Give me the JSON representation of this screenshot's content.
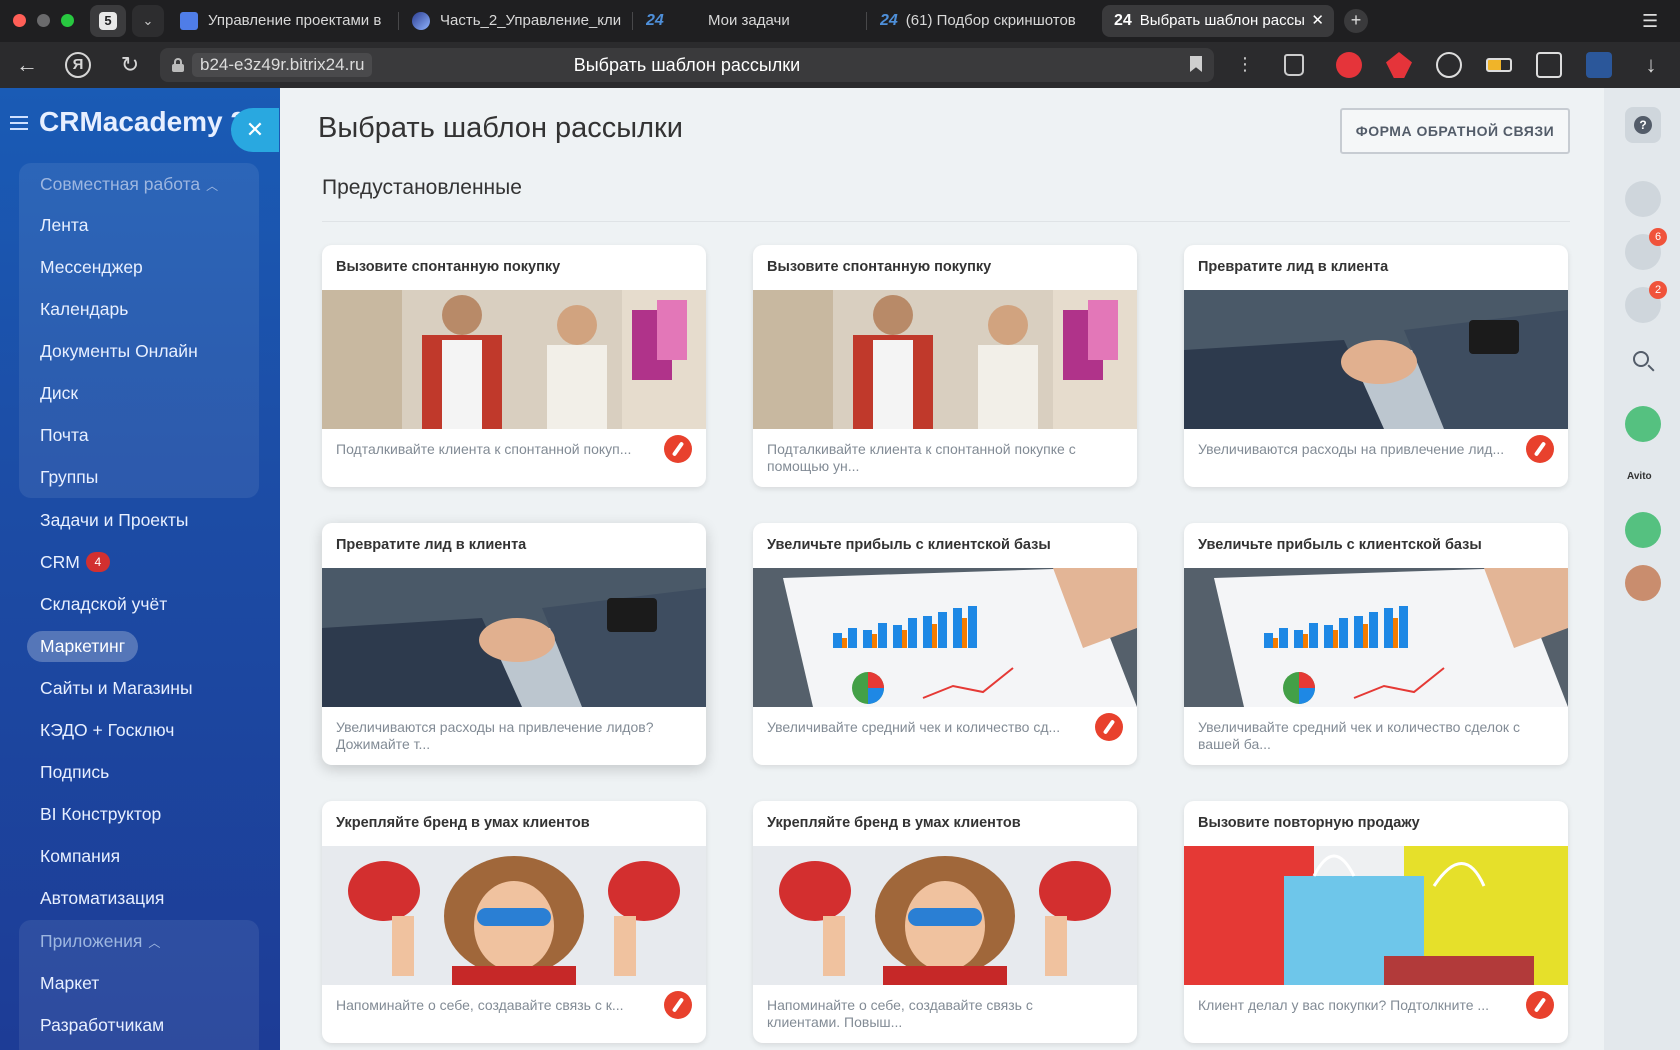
{
  "browser": {
    "tab_counter": "5",
    "tabs": [
      {
        "label": "Управление проектами в"
      },
      {
        "label": "Часть_2_Управление_кли"
      },
      {
        "label": "Мои задачи"
      },
      {
        "label": "(61) Подбор скриншотов"
      },
      {
        "label": "Выбрать шаблон рассы"
      }
    ],
    "b24_mark": "24",
    "url_domain": "b24-e3z49r.bitrix24.ru",
    "url_title": "Выбрать шаблон рассылки"
  },
  "leftmenu": {
    "logo": "CRMacademy 2",
    "items": [
      {
        "label": "Совместная работа"
      },
      {
        "label": "Лента"
      },
      {
        "label": "Мессенджер"
      },
      {
        "label": "Календарь"
      },
      {
        "label": "Документы Онлайн"
      },
      {
        "label": "Диск"
      },
      {
        "label": "Почта"
      },
      {
        "label": "Группы"
      },
      {
        "label": "Задачи и Проекты"
      },
      {
        "label": "CRM",
        "badge": "4"
      },
      {
        "label": "Складской учёт"
      },
      {
        "label": "Маркетинг"
      },
      {
        "label": "Сайты и Магазины"
      },
      {
        "label": "КЭДО + Госключ"
      },
      {
        "label": "Подпись"
      },
      {
        "label": "BI Конструктор"
      },
      {
        "label": "Компания"
      },
      {
        "label": "Автоматизация"
      },
      {
        "label": "Приложения"
      },
      {
        "label": "Маркет"
      },
      {
        "label": "Разработчикам"
      }
    ]
  },
  "content": {
    "title": "Выбрать шаблон рассылки",
    "feedback_button": "ФОРМА ОБРАТНОЙ СВЯЗИ",
    "section": "Предустановленные",
    "cards": [
      {
        "title": "Вызовите спонтанную покупку",
        "desc": "Подталкивайте клиента к спонтанной покуп...",
        "image": "shopping-couple"
      },
      {
        "title": "Вызовите спонтанную покупку",
        "desc": "Подталкивайте клиента к спонтанной покупке с помощью ун...",
        "image": "shopping-couple"
      },
      {
        "title": "Превратите лид в клиента",
        "desc": "Увеличиваются расходы на привлечение лид...",
        "image": "handshake"
      },
      {
        "title": "Превратите лид в клиента",
        "desc": "Увеличиваются расходы на привлечение лидов? Дожимайте т...",
        "image": "handshake"
      },
      {
        "title": "Увеличьте прибыль с клиентской базы",
        "desc": "Увеличивайте средний чек и количество сд...",
        "image": "chart-report"
      },
      {
        "title": "Увеличьте прибыль с клиентской базы",
        "desc": "Увеличивайте средний чек и количество сделок с вашей ба...",
        "image": "chart-report"
      },
      {
        "title": "Укрепляйте бренд в умах клиентов",
        "desc": "Напоминайте о себе, создавайте связь с к...",
        "image": "superhero-kid"
      },
      {
        "title": "Укрепляйте бренд в умах клиентов",
        "desc": "Напоминайте о себе, создавайте связь с клиентами. Повыш...",
        "image": "superhero-kid"
      },
      {
        "title": "Вызовите повторную продажу",
        "desc": "Клиент делал у вас покупки? Подтолкните ...",
        "image": "shopping-bags"
      }
    ]
  },
  "rightbar": {
    "notifications_badge": "6",
    "chat_badge": "2",
    "avito_label": "Avito"
  },
  "colors": {
    "menu_bg": "#1c4da6",
    "accent": "#29a8e0",
    "card_icon": "#e8412d",
    "badge": "#d23030"
  }
}
